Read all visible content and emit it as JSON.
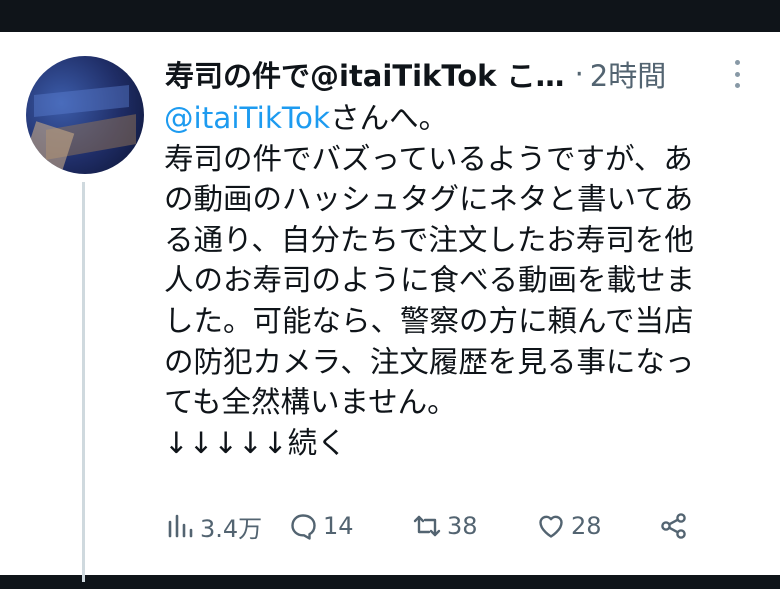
{
  "tweet": {
    "author_name": "寿司の件で@itaiTikTok こ…",
    "separator": "·",
    "time": "2時間",
    "body": {
      "mention": "@itaiTikTok",
      "mention_suffix": "さんへ。",
      "lines": [
        "寿司の件でバズっているようですが、あ",
        "の動画のハッシュタグにネタと書いてあ",
        "る通り、自分たちで注文したお寿司を他",
        "人のお寿司のように食べる動画を載せま",
        "した。可能なら、警察の方に頼んで当店",
        "の防犯カメラ、注文履歴を見る事になっ",
        "ても全然構いません。",
        "↓↓↓↓↓続く"
      ]
    },
    "stats": {
      "views": "3.4万",
      "replies": "14",
      "retweets": "38",
      "likes": "28"
    }
  }
}
